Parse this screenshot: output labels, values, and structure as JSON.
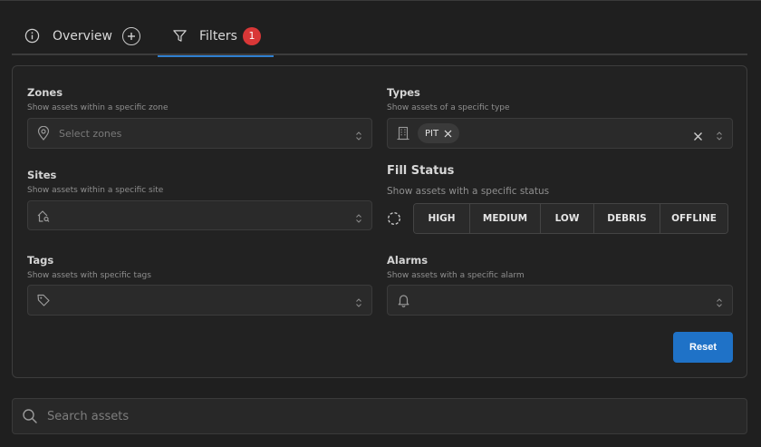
{
  "tabs": {
    "overview": {
      "label": "Overview",
      "icon": "info-icon"
    },
    "add": {
      "icon": "plus-icon"
    },
    "filters": {
      "label": "Filters",
      "badge": "1",
      "icon": "filter-icon"
    }
  },
  "filters": {
    "zones": {
      "label": "Zones",
      "description": "Show assets within a specific zone",
      "placeholder": "Select zones",
      "icon": "map-pin-icon"
    },
    "sites": {
      "label": "Sites",
      "description": "Show assets within a specific site",
      "icon": "house-search-icon"
    },
    "tags": {
      "label": "Tags",
      "description": "Show assets with specific tags",
      "icon": "tag-icon"
    },
    "types": {
      "label": "Types",
      "description": "Show assets of a specific type",
      "icon": "building-icon",
      "selected": [
        "PIT"
      ]
    },
    "fill_status": {
      "label": "Fill Status",
      "description": "Show assets with a specific status",
      "icon": "dashed-circle-icon",
      "options": [
        "HIGH",
        "MEDIUM",
        "LOW",
        "DEBRIS",
        "OFFLINE"
      ]
    },
    "alarms": {
      "label": "Alarms",
      "description": "Show assets with a specific alarm",
      "icon": "bell-icon"
    }
  },
  "reset_label": "Reset",
  "search": {
    "placeholder": "Search assets",
    "icon": "search-icon"
  },
  "colors": {
    "accent": "#2f80d0",
    "badge": "#d93737",
    "button": "#1f72c7"
  }
}
